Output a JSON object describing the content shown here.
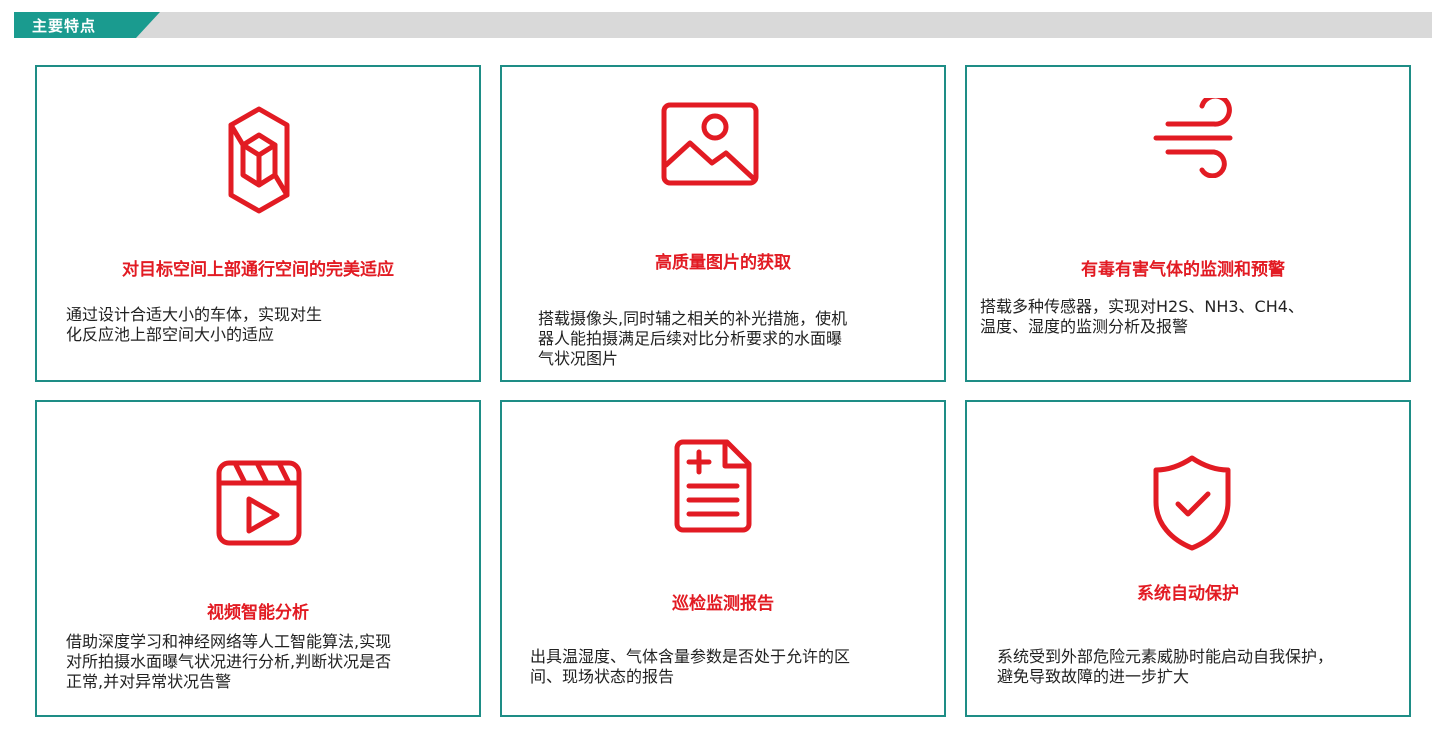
{
  "header": {
    "title": "主要特点"
  },
  "cards": [
    {
      "icon": "cube-icon",
      "title": "对目标空间上部通行空间的完美适应",
      "desc_lines": [
        "通过设计合适大小的车体，实现对生",
        "化反应池上部空间大小的适应"
      ]
    },
    {
      "icon": "image-icon",
      "title": "高质量图片的获取",
      "desc_lines": [
        "搭载摄像头,同时辅之相关的补光措施，使机",
        "器人能拍摄满足后续对比分析要求的水面曝",
        "气状况图片"
      ]
    },
    {
      "icon": "wind-icon",
      "title": "有毒有害气体的监测和预警",
      "desc_lines": [
        "搭载多种传感器，实现对H2S、NH3、CH4、",
        "温度、湿度的监测分析及报警"
      ]
    },
    {
      "icon": "video-play-icon",
      "title": "视频智能分析",
      "desc_lines": [
        "借助深度学习和神经网络等人工智能算法,实现",
        "对所拍摄水面曝气状况进行分析,判断状况是否",
        "正常,并对异常状况告警"
      ]
    },
    {
      "icon": "report-document-icon",
      "title": "巡检监测报告",
      "desc_lines": [
        "出具温湿度、气体含量参数是否处于允许的区",
        "间、现场状态的报告"
      ]
    },
    {
      "icon": "shield-check-icon",
      "title": "系统自动保护",
      "desc_lines": [
        "系统受到外部危险元素威胁时能启动自我保护，",
        "避免导致故障的进一步扩大"
      ]
    }
  ],
  "colors": {
    "accent": "#e21b23",
    "border": "#1e8d86",
    "header_tab": "#1a9b8f",
    "header_bar": "#d9d9d9"
  }
}
